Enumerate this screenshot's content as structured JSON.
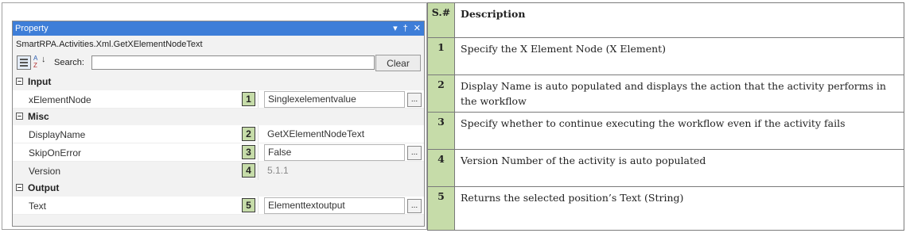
{
  "panel": {
    "title": "Property",
    "title_icons": [
      "▾",
      "†",
      "✕"
    ],
    "type_name": "SmartRPA.Activities.Xml.GetXElementNodeText",
    "toolbar": {
      "search_label": "Search:",
      "search_value": "",
      "clear_label": "Clear"
    },
    "categories": [
      {
        "label": "Input",
        "properties": [
          {
            "name": "xElementNode",
            "badge": "1",
            "value": "Singlexelementvalue"
          }
        ]
      },
      {
        "label": "Misc",
        "properties": [
          {
            "name": "DisplayName",
            "badge": "2",
            "value": "GetXElementNodeText"
          },
          {
            "name": "SkipOnError",
            "badge": "3",
            "value": "False"
          },
          {
            "name": "Version",
            "badge": "4",
            "value": "5.1.1"
          }
        ]
      },
      {
        "label": "Output",
        "properties": [
          {
            "name": "Text",
            "badge": "5",
            "value": "Elementtextoutput"
          }
        ]
      }
    ],
    "ellipsis": "..."
  },
  "table": {
    "header_sn": "S.#",
    "header_desc": "Description",
    "rows": [
      {
        "sn": "1",
        "desc": "Specify the X Element Node (X Element)"
      },
      {
        "sn": "2",
        "desc": "Display Name is auto populated and displays the action that the activity performs in the workflow"
      },
      {
        "sn": "3",
        "desc": "Specify whether to continue executing the workflow even if the activity fails"
      },
      {
        "sn": "4",
        "desc": "Version Number of the activity is auto populated"
      },
      {
        "sn": "5",
        "desc": "Returns the selected position’s Text (String)"
      }
    ]
  }
}
